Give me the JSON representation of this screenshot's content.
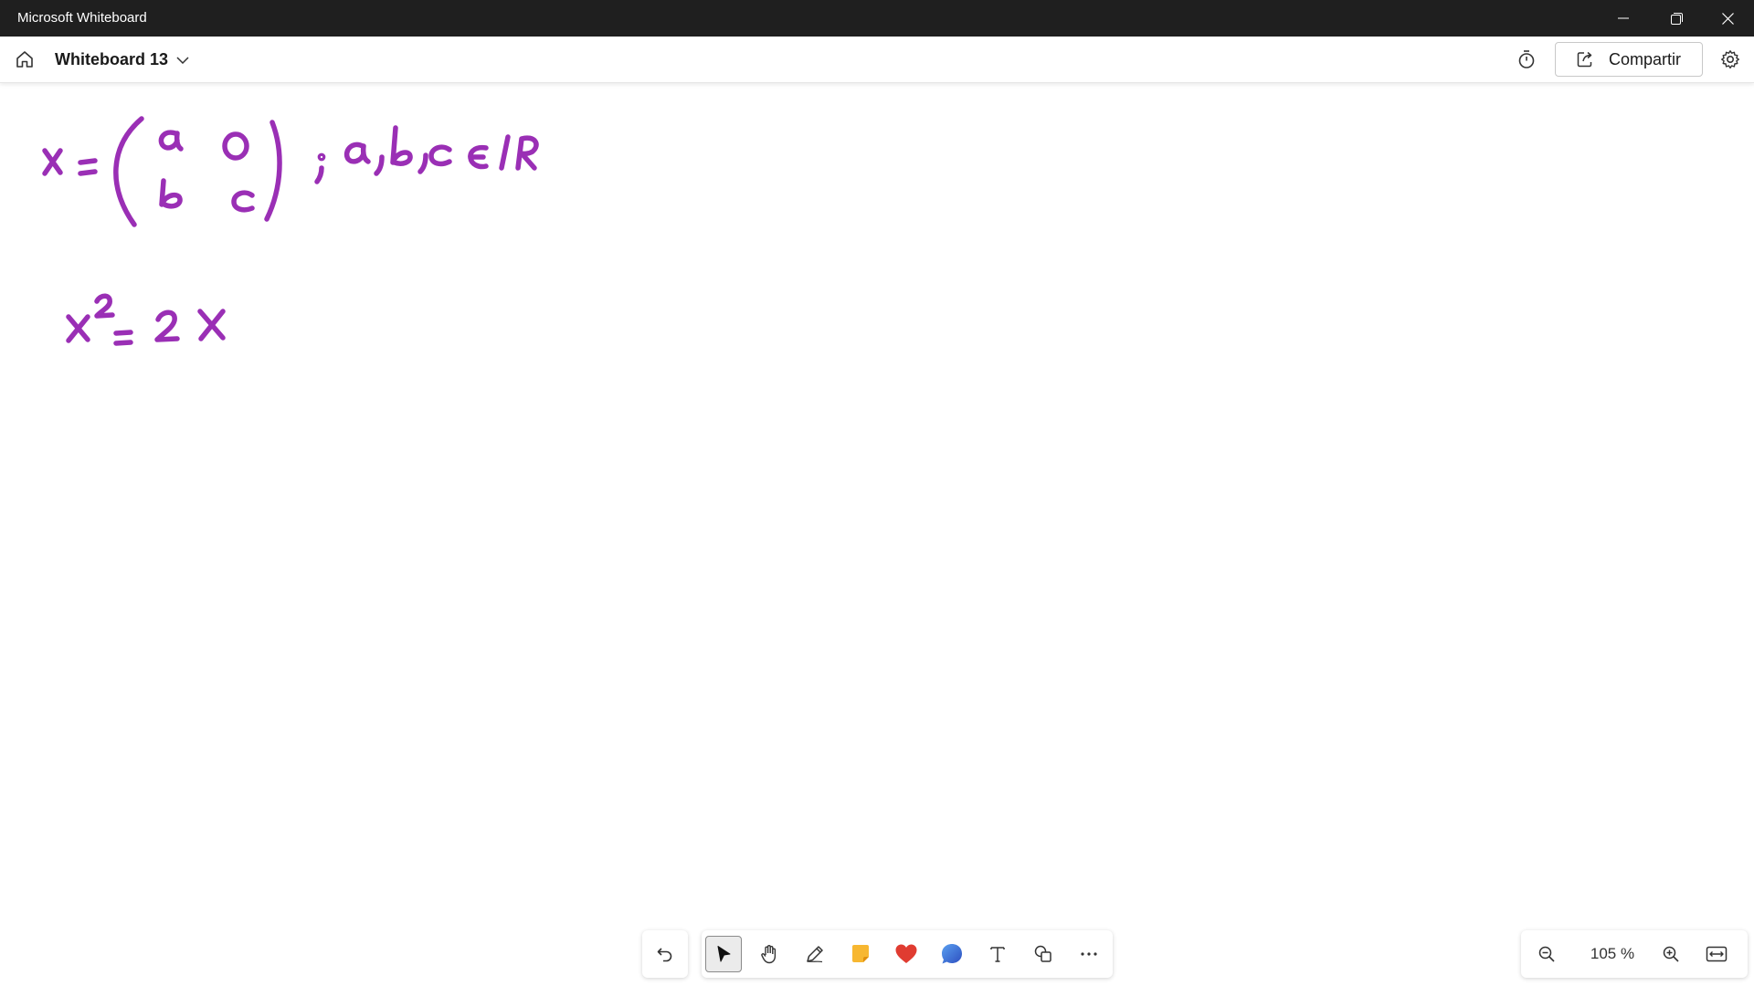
{
  "window": {
    "title": "Microsoft Whiteboard",
    "controls": [
      "minimize",
      "restore",
      "close"
    ]
  },
  "appbar": {
    "board_name": "Whiteboard 13",
    "share_label": "Compartir",
    "icons": [
      "home-icon",
      "chevron-down-icon",
      "timer-icon",
      "share-icon",
      "gear-icon"
    ]
  },
  "canvas": {
    "ink_color": "#9a2fb5",
    "handwritten_content": [
      "X = ( a 0 ; b c ) ; a,b,c ∈ IR",
      "X² = 2X"
    ]
  },
  "toolbar": {
    "tools": [
      "undo-icon",
      "select-icon",
      "hand-icon",
      "pen-icon",
      "sticky-note-icon",
      "reactions-icon",
      "comment-icon",
      "text-icon",
      "shapes-icon",
      "more-icon"
    ],
    "active_tool": "select"
  },
  "zoom": {
    "level_label": "105 %",
    "level": 105
  },
  "colors": {
    "titlebar_bg": "#1f1f1f",
    "ink": "#9a2fb5",
    "sticky_note": "#f7b731",
    "heart": "#e03c31",
    "comment": "#3a6fd8"
  }
}
